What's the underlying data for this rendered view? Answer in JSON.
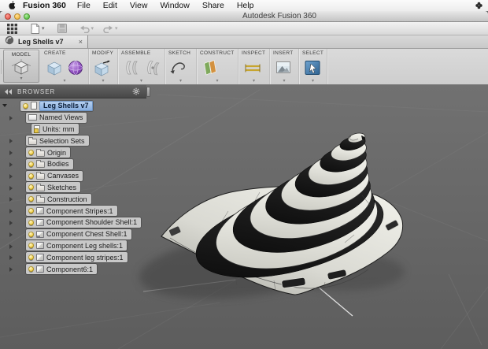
{
  "colors": {
    "selection_blue": "#84abde",
    "viewport_gray": "#666666",
    "ribbon_gray": "#d4d4d4",
    "browser_header": "#4d4d4d",
    "stripe_black": "#141414",
    "shell_white": "#e9e9e2"
  },
  "menubar": {
    "app_name": "Fusion 360",
    "items": [
      "File",
      "Edit",
      "View",
      "Window",
      "Share",
      "Help"
    ],
    "icons": [
      "apple-icon",
      "status-icon"
    ]
  },
  "titlebar": {
    "title": "Autodesk Fusion 360",
    "window_controls": [
      "close",
      "minimize",
      "zoom"
    ]
  },
  "quick_toolbar": {
    "buttons": [
      {
        "icon": "app-grid-icon",
        "caret": false,
        "enabled": true
      },
      {
        "icon": "new-design-icon",
        "caret": true,
        "enabled": true
      },
      {
        "icon": "save-icon",
        "caret": false,
        "enabled": false
      },
      {
        "icon": "undo-icon",
        "caret": true,
        "enabled": false
      },
      {
        "icon": "redo-icon",
        "caret": true,
        "enabled": false
      }
    ]
  },
  "tabbar": {
    "active_tab": {
      "icon": "fusion-logo-icon",
      "label": "Leg Shells v7",
      "close_glyph": "×"
    }
  },
  "ribbon": {
    "model_button": {
      "label": "MODEL",
      "icon": "model-workspace-icon"
    },
    "groups": [
      {
        "id": "create",
        "label": "CREATE",
        "icons": [
          "box-primitive-icon",
          "form-sphere-icon"
        ]
      },
      {
        "id": "modify",
        "label": "MODIFY",
        "icons": [
          "press-pull-icon"
        ]
      },
      {
        "id": "assemble",
        "label": "ASSEMBLE",
        "icons": [
          "joint-icon",
          "as-built-joint-icon"
        ]
      },
      {
        "id": "sketch",
        "label": "SKETCH",
        "icons": [
          "create-sketch-icon"
        ]
      },
      {
        "id": "construct",
        "label": "CONSTRUCT",
        "icons": [
          "construct-plane-icon"
        ]
      },
      {
        "id": "inspect",
        "label": "INSPECT",
        "icons": [
          "measure-icon"
        ]
      },
      {
        "id": "insert",
        "label": "INSERT",
        "icons": [
          "insert-image-icon"
        ]
      },
      {
        "id": "select",
        "label": "SELECT",
        "icons": [
          "select-icon"
        ]
      }
    ]
  },
  "browser": {
    "title": "BROWSER",
    "header_icons": [
      "collapse-panel-icon",
      "gear-icon"
    ],
    "items": [
      {
        "label": "Leg Shells v7",
        "indent": 0,
        "bulb": true,
        "icon": "document",
        "selected": true,
        "expander": "expanded"
      },
      {
        "label": "Named Views",
        "indent": 1,
        "bulb": false,
        "icon": "views",
        "selected": false,
        "expander": "collapsed"
      },
      {
        "label": "Units: mm",
        "indent": 2,
        "bulb": false,
        "icon": "units-doc",
        "selected": false,
        "expander": "none"
      },
      {
        "label": "Selection Sets",
        "indent": 1,
        "bulb": false,
        "icon": "folder",
        "selected": false,
        "expander": "collapsed"
      },
      {
        "label": "Origin",
        "indent": 1,
        "bulb": true,
        "icon": "folder",
        "selected": false,
        "expander": "collapsed"
      },
      {
        "label": "Bodies",
        "indent": 1,
        "bulb": true,
        "icon": "folder",
        "selected": false,
        "expander": "collapsed"
      },
      {
        "label": "Canvases",
        "indent": 1,
        "bulb": true,
        "icon": "folder",
        "selected": false,
        "expander": "collapsed"
      },
      {
        "label": "Sketches",
        "indent": 1,
        "bulb": true,
        "icon": "folder",
        "selected": false,
        "expander": "collapsed"
      },
      {
        "label": "Construction",
        "indent": 1,
        "bulb": true,
        "icon": "folder",
        "selected": false,
        "expander": "collapsed"
      },
      {
        "label": "Component Stripes:1",
        "indent": 1,
        "bulb": true,
        "icon": "component",
        "selected": false,
        "expander": "collapsed"
      },
      {
        "label": "Component Shoulder Shell:1",
        "indent": 1,
        "bulb": true,
        "icon": "component",
        "selected": false,
        "expander": "collapsed"
      },
      {
        "label": "Component Chest Shell:1",
        "indent": 1,
        "bulb": true,
        "icon": "component-grounded",
        "selected": false,
        "expander": "collapsed"
      },
      {
        "label": "Component Leg shells:1",
        "indent": 1,
        "bulb": true,
        "icon": "component",
        "selected": false,
        "expander": "collapsed"
      },
      {
        "label": "Component leg stripes:1",
        "indent": 1,
        "bulb": true,
        "icon": "component",
        "selected": false,
        "expander": "collapsed"
      },
      {
        "label": "Component6:1",
        "indent": 1,
        "bulb": true,
        "icon": "component",
        "selected": false,
        "expander": "collapsed"
      }
    ]
  },
  "viewport": {
    "model": "striped-shell-3d-model"
  }
}
